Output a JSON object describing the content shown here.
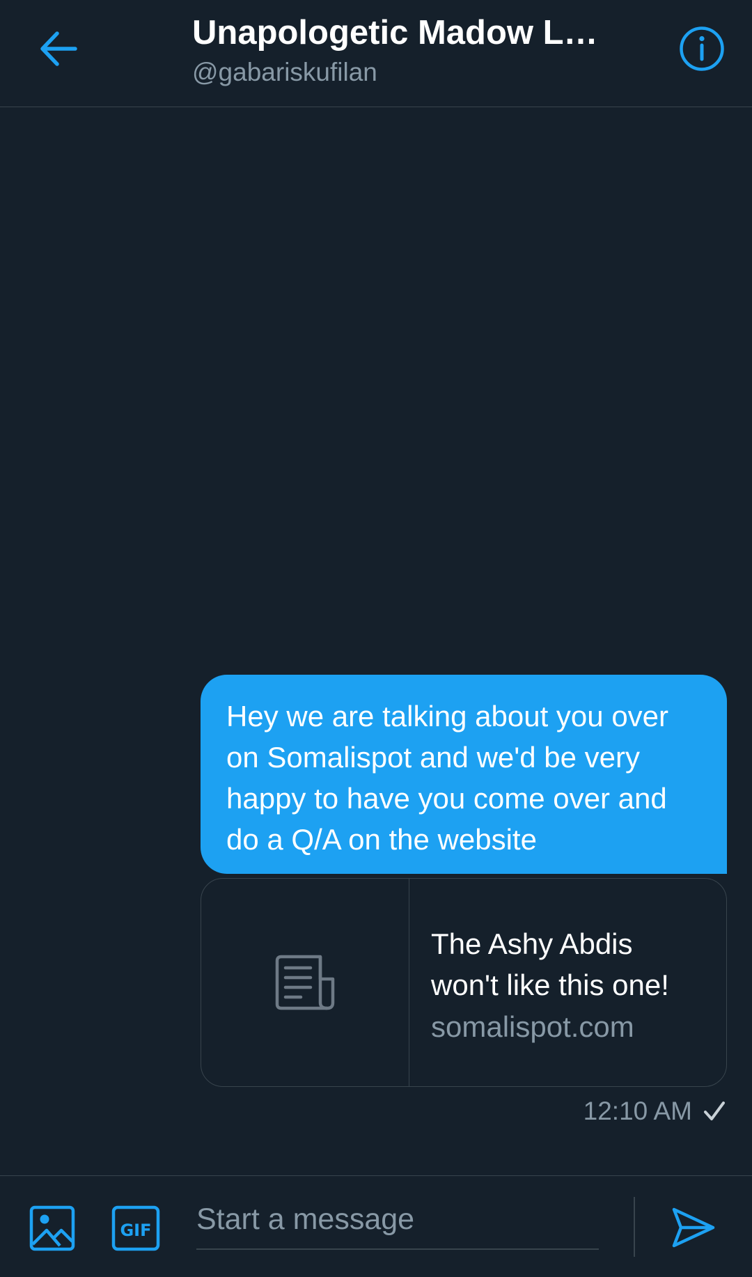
{
  "header": {
    "title": "Unapologetic Madow L…",
    "handle": "@gabariskufilan",
    "back_icon": "arrow-left-icon",
    "info_icon": "info-circle-icon"
  },
  "conversation": {
    "message": {
      "text": "Hey we are talking about you over on Somalispot and we'd be very happy to have you come over and do a Q/A on the website",
      "direction": "sent"
    },
    "link_card": {
      "title": "The Ashy Abdis won't like this one!",
      "domain": "somalispot.com",
      "thumbnail_icon": "article-document-icon"
    },
    "timestamp": "12:10 AM",
    "status_icon": "checkmark-icon"
  },
  "composer": {
    "placeholder": "Start a message",
    "value": "",
    "media_icon": "image-icon",
    "gif_label": "GIF",
    "send_icon": "send-icon"
  },
  "colors": {
    "background": "#15202b",
    "accent": "#1da1f2",
    "border": "#38444d",
    "secondary_text": "#8899a6"
  }
}
